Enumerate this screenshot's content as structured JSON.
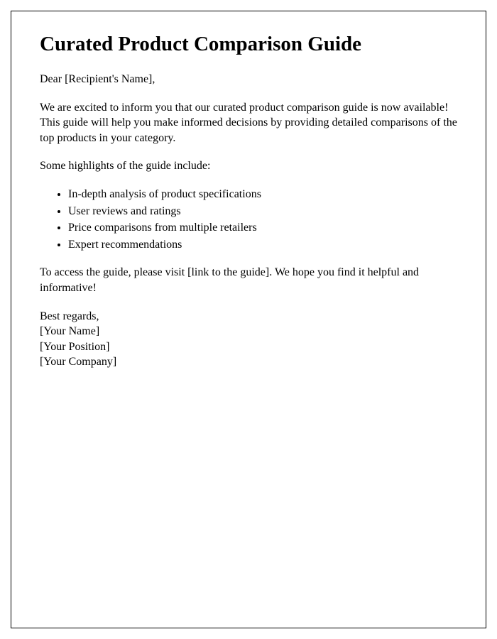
{
  "title": "Curated Product Comparison Guide",
  "greeting": "Dear [Recipient's Name],",
  "intro": "We are excited to inform you that our curated product comparison guide is now available! This guide will help you make informed decisions by providing detailed comparisons of the top products in your category.",
  "highlights_label": "Some highlights of the guide include:",
  "highlights": {
    "0": "In-depth analysis of product specifications",
    "1": "User reviews and ratings",
    "2": "Price comparisons from multiple retailers",
    "3": "Expert recommendations"
  },
  "access_text": "To access the guide, please visit [link to the guide]. We hope you find it helpful and informative!",
  "signature": {
    "closing": "Best regards,",
    "name": "[Your Name]",
    "position": "[Your Position]",
    "company": "[Your Company]"
  }
}
